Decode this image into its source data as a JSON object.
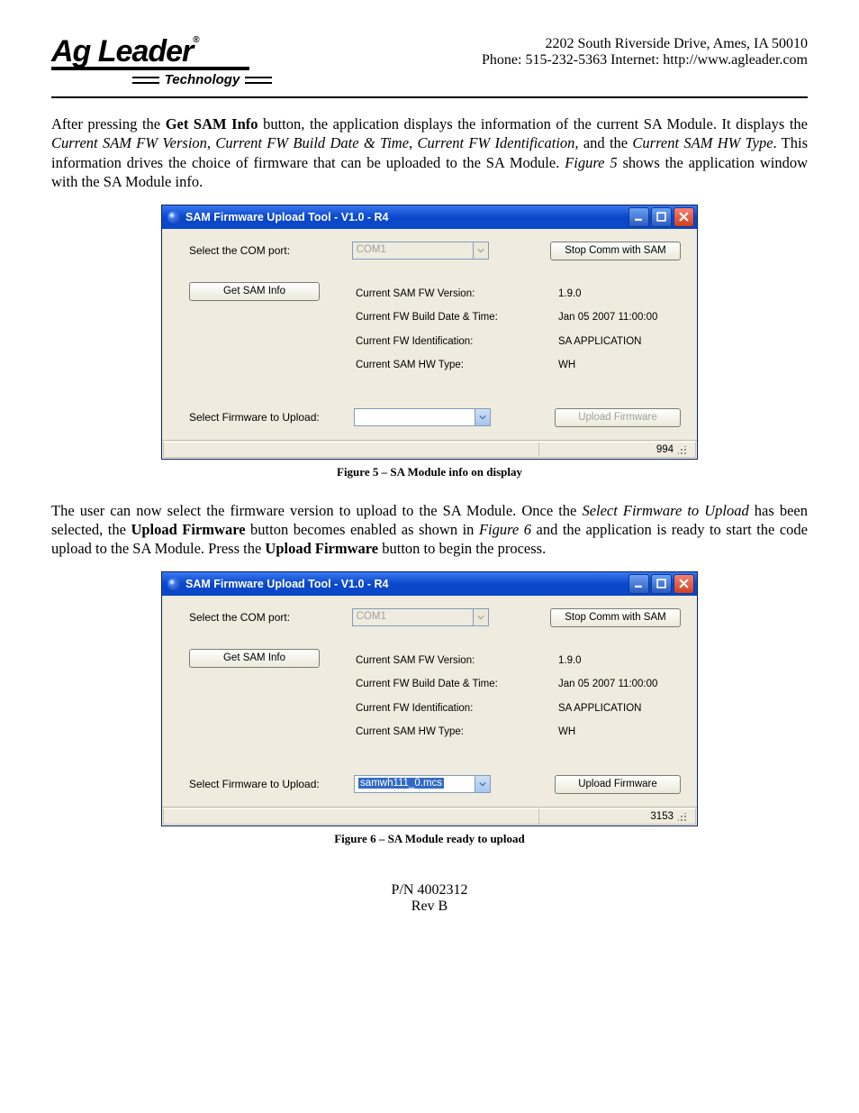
{
  "header": {
    "brand": "Ag Leader",
    "tech": "Technology",
    "address": "2202 South Riverside Drive, Ames, IA  50010",
    "phone_line": "Phone: 515-232-5363 Internet:  http://www.agleader.com"
  },
  "para1": {
    "p1a": "After pressing the ",
    "p1b": "Get SAM Info",
    "p1c": " button, the application displays the information of the current SA Module. It displays the ",
    "p1d": "Current SAM FW Version, Current FW Build Date & Time, Current FW Identification,",
    "p1e": " and the ",
    "p1f": "Current SAM HW Type",
    "p1g": ". This information drives the choice of firmware that can be uploaded to the SA Module. ",
    "p1h": "Figure 5",
    "p1i": " shows the application window with the SA Module info."
  },
  "fig5": {
    "title": "SAM Firmware Upload Tool - V1.0 - R4",
    "com_label": "Select the COM port:",
    "com_value": "COM1",
    "stop_btn": "Stop Comm with SAM",
    "get_btn": "Get SAM Info",
    "info_labels": {
      "l1": "Current SAM FW Version:",
      "l2": "Current FW Build Date & Time:",
      "l3": "Current FW Identification:",
      "l4": "Current SAM HW Type:"
    },
    "info_vals": {
      "v1": "1.9.0",
      "v2": "Jan 05 2007 11:00:00",
      "v3": "SA APPLICATION",
      "v4": "WH"
    },
    "fw_label": "Select Firmware to Upload:",
    "fw_value": "",
    "upload_btn": "Upload Firmware",
    "status": "994",
    "caption": "Figure 5 – SA Module info on display"
  },
  "para2": {
    "p2a": "The user can now select the firmware version to upload to the SA Module. Once the ",
    "p2b": "Select Firmware to Upload",
    "p2c": " has been selected, the ",
    "p2d": "Upload Firmware",
    "p2e": " button becomes enabled as shown in ",
    "p2f": "Figure 6",
    "p2g": " and the application is ready to start the code upload to the SA Module. Press the ",
    "p2h": "Upload Firmware",
    "p2i": " button to begin the process."
  },
  "fig6": {
    "title": "SAM Firmware Upload Tool - V1.0 - R4",
    "com_label": "Select the COM port:",
    "com_value": "COM1",
    "stop_btn": "Stop Comm with SAM",
    "get_btn": "Get SAM Info",
    "info_labels": {
      "l1": "Current SAM FW Version:",
      "l2": "Current FW Build Date & Time:",
      "l3": "Current FW Identification:",
      "l4": "Current SAM HW Type:"
    },
    "info_vals": {
      "v1": "1.9.0",
      "v2": "Jan 05 2007 11:00:00",
      "v3": "SA APPLICATION",
      "v4": "WH"
    },
    "fw_label": "Select Firmware to Upload:",
    "fw_value": "samwh111_0.mcs",
    "upload_btn": "Upload Firmware",
    "status": "3153",
    "caption": "Figure 6 – SA Module ready to upload"
  },
  "footer": {
    "pn": "P/N 4002312",
    "rev": "Rev B"
  }
}
